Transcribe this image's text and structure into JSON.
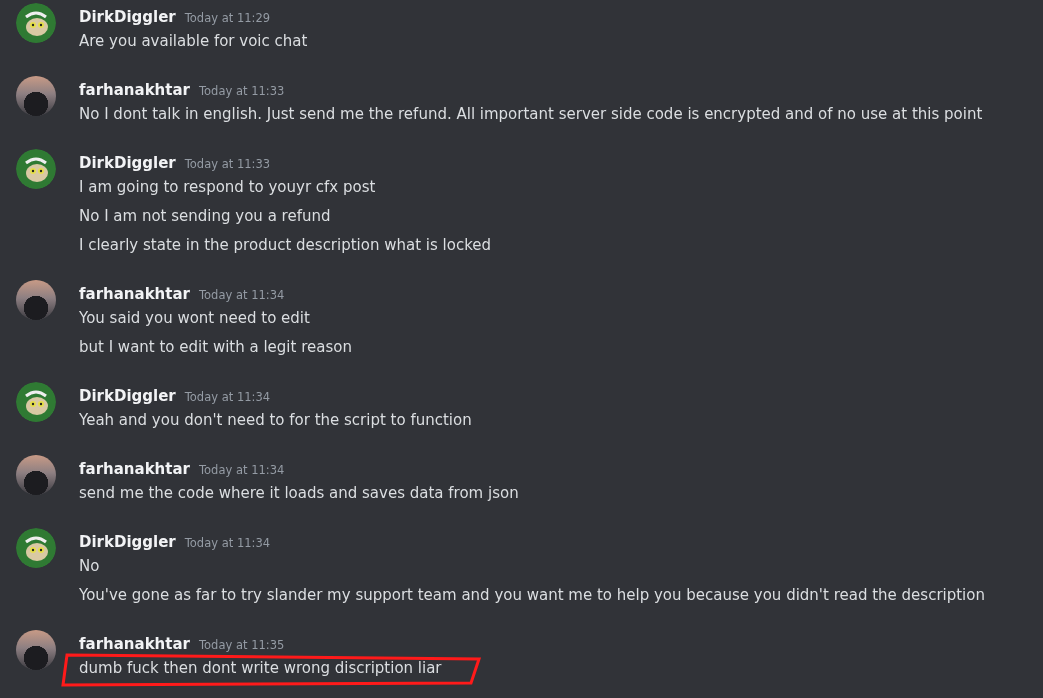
{
  "messages": [
    {
      "author": "DirkDiggler",
      "kind": "monkey",
      "time": "Today at 11:29",
      "lines": [
        {
          "text": "Are you available for voic chat",
          "circled": false
        }
      ]
    },
    {
      "author": "farhanakhtar",
      "kind": "photo",
      "time": "Today at 11:33",
      "lines": [
        {
          "text": "No I dont talk in english. Just send me the refund. All important server side code is encrypted and of no use at this point",
          "circled": false
        }
      ]
    },
    {
      "author": "DirkDiggler",
      "kind": "monkey",
      "time": "Today at 11:33",
      "lines": [
        {
          "text": "I am going to respond to youyr cfx post",
          "circled": false
        },
        {
          "text": "No I am not sending you a refund",
          "circled": false
        },
        {
          "text": "I clearly state in the product description what is locked",
          "circled": false
        }
      ]
    },
    {
      "author": "farhanakhtar",
      "kind": "photo",
      "time": "Today at 11:34",
      "lines": [
        {
          "text": "You said you wont need to edit",
          "circled": false
        },
        {
          "text": "but I want to edit with a legit reason",
          "circled": false
        }
      ]
    },
    {
      "author": "DirkDiggler",
      "kind": "monkey",
      "time": "Today at 11:34",
      "lines": [
        {
          "text": "Yeah and you don't need to for the script to function",
          "circled": false
        }
      ]
    },
    {
      "author": "farhanakhtar",
      "kind": "photo",
      "time": "Today at 11:34",
      "lines": [
        {
          "text": "send me the code where it loads and saves data from json",
          "circled": false
        }
      ]
    },
    {
      "author": "DirkDiggler",
      "kind": "monkey",
      "time": "Today at 11:34",
      "lines": [
        {
          "text": "No",
          "circled": false
        },
        {
          "text": "You've gone as far to try slander my support team and you want me to help you because you didn't read the description",
          "circled": false
        }
      ]
    },
    {
      "author": "farhanakhtar",
      "kind": "photo",
      "time": "Today at 11:35",
      "lines": [
        {
          "text": "dumb fuck then dont write wrong discription liar",
          "circled": true
        }
      ]
    }
  ]
}
